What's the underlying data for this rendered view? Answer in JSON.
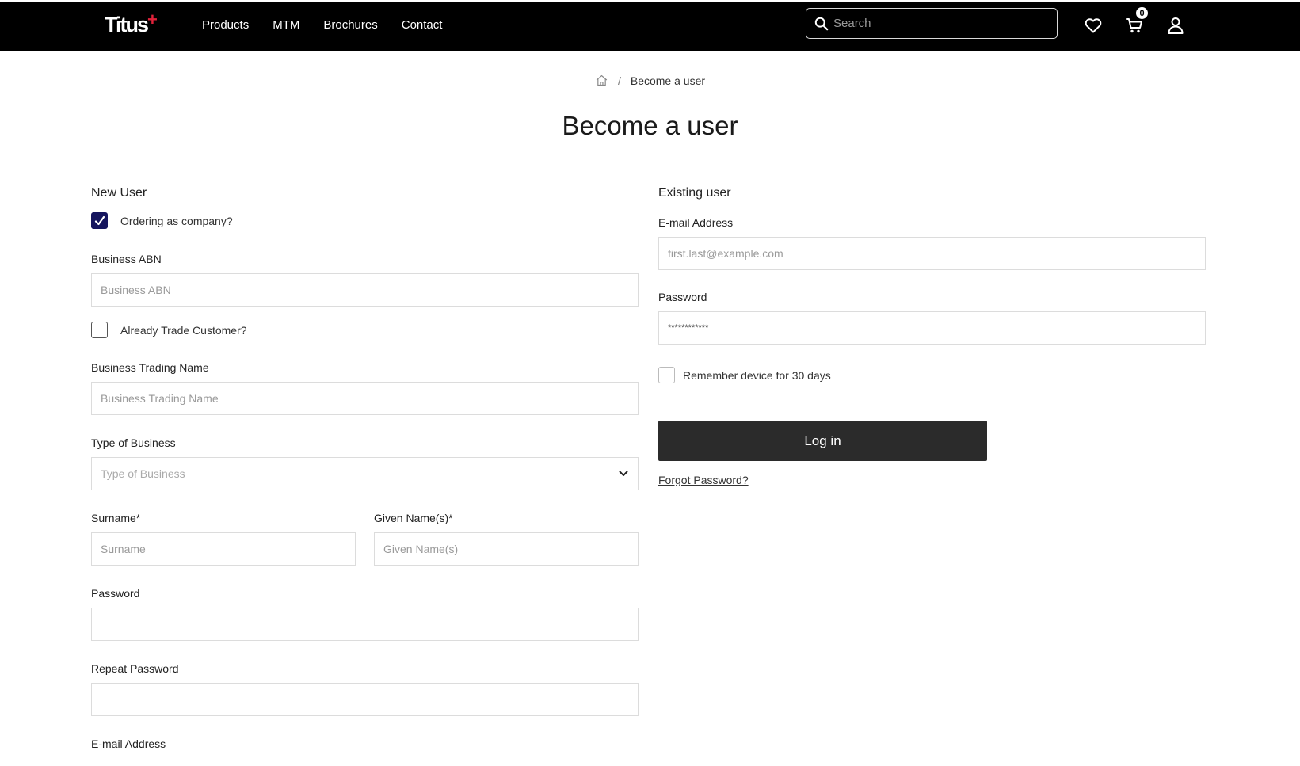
{
  "header": {
    "logo": "Titus",
    "logo_mark": "+",
    "nav": [
      "Products",
      "MTM",
      "Brochures",
      "Contact"
    ],
    "search_placeholder": "Search",
    "cart_count": "0",
    "icons": [
      "search-icon",
      "heart-icon",
      "cart-icon",
      "user-icon"
    ]
  },
  "breadcrumb": {
    "home_icon": "home-icon",
    "separator": "/",
    "current": "Become a user"
  },
  "page_title": "Become a user",
  "new_user": {
    "title": "New User",
    "ordering_as_company_label": "Ordering as company?",
    "ordering_as_company_checked": true,
    "business_abn": {
      "label": "Business ABN",
      "placeholder": "Business ABN"
    },
    "already_trade_label": "Already Trade Customer?",
    "already_trade_checked": false,
    "trading_name": {
      "label": "Business Trading Name",
      "placeholder": "Business Trading Name"
    },
    "type_of_business": {
      "label": "Type of Business",
      "placeholder": "Type of Business"
    },
    "surname": {
      "label": "Surname*",
      "placeholder": "Surname"
    },
    "given_names": {
      "label": "Given Name(s)*",
      "placeholder": "Given Name(s)"
    },
    "password": {
      "label": "Password",
      "placeholder": ""
    },
    "repeat_password": {
      "label": "Repeat Password",
      "placeholder": ""
    },
    "email": {
      "label": "E-mail Address"
    }
  },
  "existing_user": {
    "title": "Existing user",
    "email": {
      "label": "E-mail Address",
      "placeholder": "first.last@example.com"
    },
    "password": {
      "label": "Password",
      "value": "************"
    },
    "remember_label": "Remember device for 30 days",
    "remember_checked": false,
    "login_label": "Log in",
    "forgot_label": "Forgot Password?"
  },
  "colors": {
    "header_bg": "#000000",
    "brand_accent": "#e0223a",
    "checkbox_checked": "#15155e",
    "button_bg": "#2b2b2b"
  }
}
